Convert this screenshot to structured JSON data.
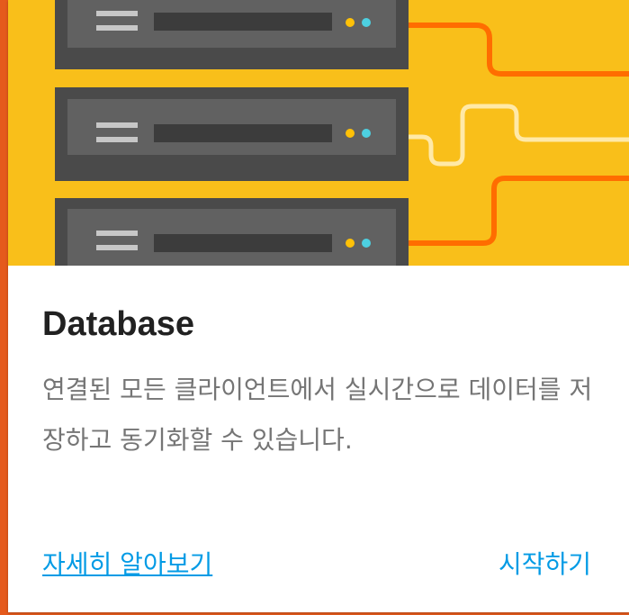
{
  "card": {
    "title": "Database",
    "description": "연결된 모든 클라이언트에서 실시간으로 데이터를 저장하고 동기화할 수 있습니다.",
    "learn_more_label": "자세히 알아보기",
    "get_started_label": "시작하기"
  },
  "hero": {
    "illustration": "server-rack-illustration",
    "colors": {
      "background": "#f9bf1a",
      "server": "#5f5f5f",
      "wire_orange": "#ff6d00",
      "wire_light": "#ffe9a8",
      "led_yellow": "#ffc107",
      "led_blue": "#4dd0e1"
    }
  },
  "colors": {
    "accent_link": "#039be5",
    "page_background": "#e55a1c"
  }
}
